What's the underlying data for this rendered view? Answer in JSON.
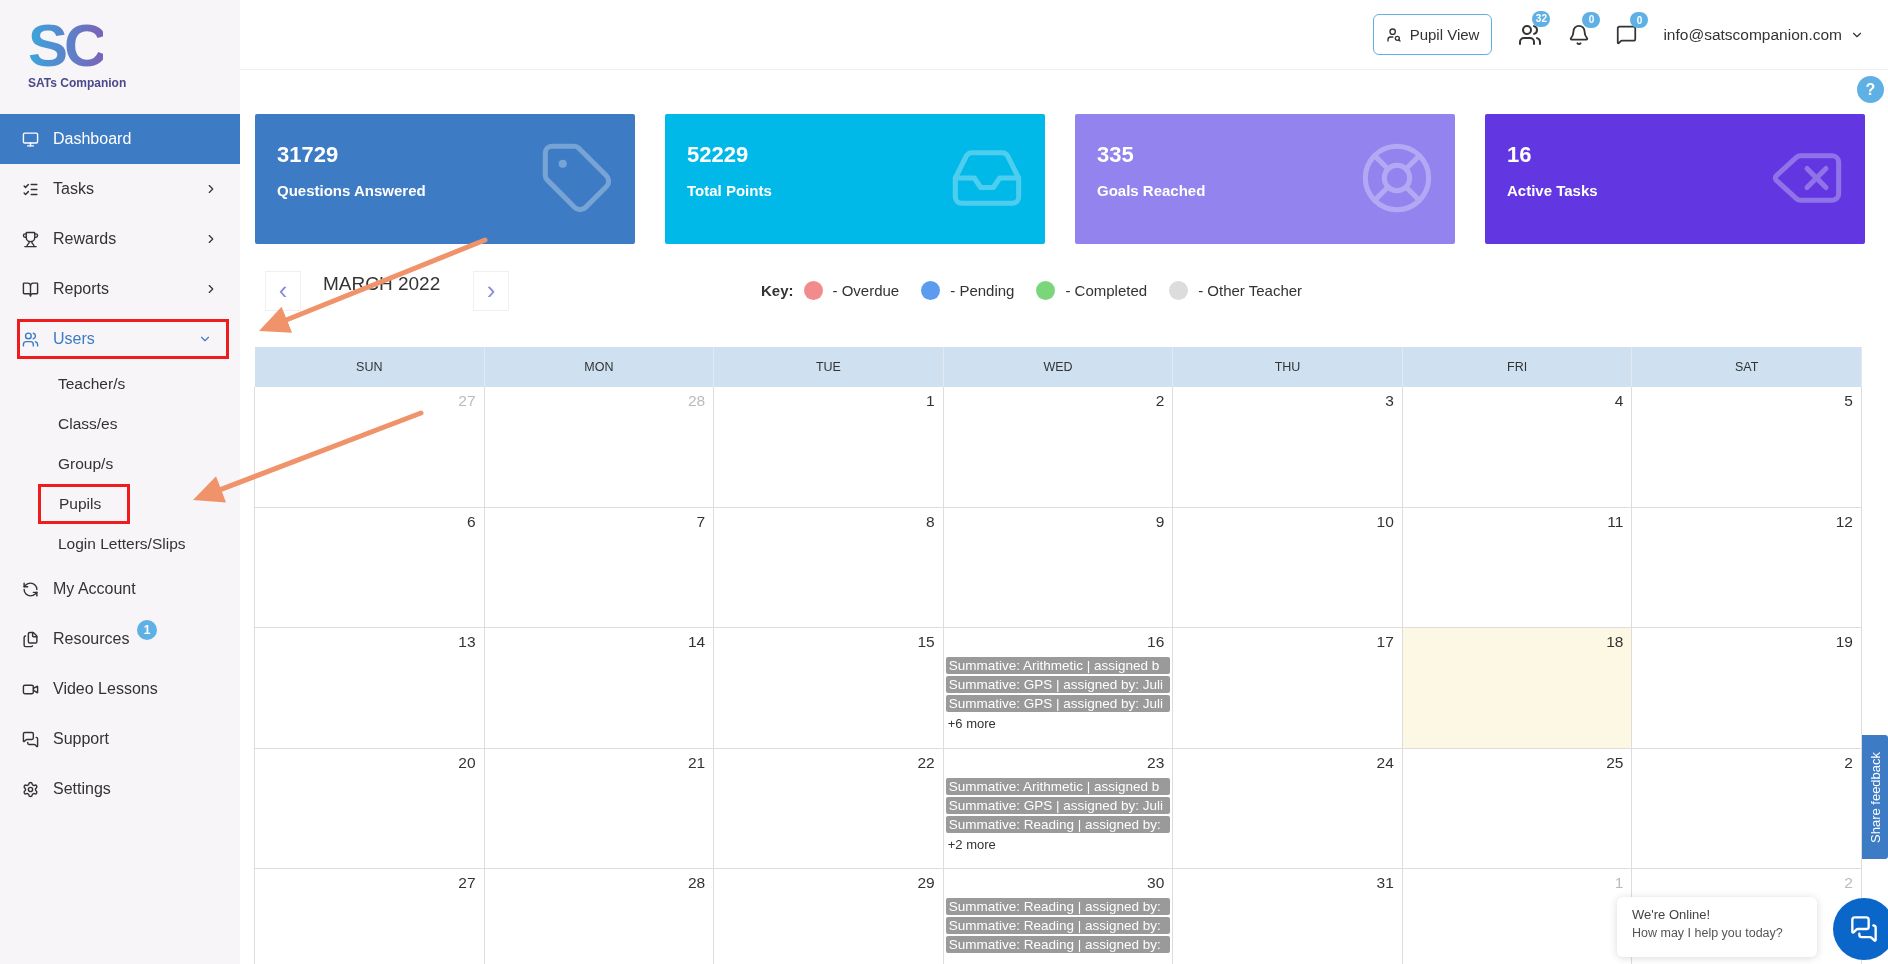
{
  "logo": {
    "mark": "SC",
    "name": "SATs Companion"
  },
  "sidebar": {
    "items": [
      {
        "label": "Dashboard",
        "selected": true,
        "has_arrow": false
      },
      {
        "label": "Tasks",
        "selected": false,
        "has_arrow": true
      },
      {
        "label": "Rewards",
        "selected": false,
        "has_arrow": true
      },
      {
        "label": "Reports",
        "selected": false,
        "has_arrow": true
      },
      {
        "label": "Users",
        "selected": false,
        "has_arrow": true,
        "expanded": true,
        "highlighted": true,
        "children": [
          {
            "label": "Teacher/s",
            "highlighted": false
          },
          {
            "label": "Class/es",
            "highlighted": false
          },
          {
            "label": "Group/s",
            "highlighted": false
          },
          {
            "label": "Pupils",
            "highlighted": true
          },
          {
            "label": "Login Letters/Slips",
            "highlighted": false
          }
        ]
      },
      {
        "label": "My Account",
        "selected": false,
        "has_arrow": false
      },
      {
        "label": "Resources",
        "selected": false,
        "has_arrow": false,
        "badge": "1"
      },
      {
        "label": "Video Lessons",
        "selected": false,
        "has_arrow": false
      },
      {
        "label": "Support",
        "selected": false,
        "has_arrow": false
      },
      {
        "label": "Settings",
        "selected": false,
        "has_arrow": false
      }
    ]
  },
  "header": {
    "pupil_view": "Pupil View",
    "pupils_badge": "32",
    "notifications_badge": "0",
    "messages_badge": "0",
    "account": "info@satscompanion.com",
    "help": "?"
  },
  "stats": [
    {
      "value": "31729",
      "label": "Questions Answered",
      "color": "#3d7bc4"
    },
    {
      "value": "52229",
      "label": "Total Points",
      "color": "#00b9e8"
    },
    {
      "value": "335",
      "label": "Goals Reached",
      "color": "#9283ef"
    },
    {
      "value": "16",
      "label": "Active Tasks",
      "color": "#6236e0"
    }
  ],
  "calendar": {
    "title": "MARCH 2022",
    "prev": "‹",
    "next": "›",
    "key": {
      "label": "Key:",
      "items": [
        {
          "label": "- Overdue",
          "color": "#f28b8b"
        },
        {
          "label": "- Pending",
          "color": "#5b9bf0"
        },
        {
          "label": "- Completed",
          "color": "#7bd67b"
        },
        {
          "label": "- Other Teacher",
          "color": "#dcdcdc"
        }
      ]
    },
    "weekdays": [
      "SUN",
      "MON",
      "TUE",
      "WED",
      "THU",
      "FRI",
      "SAT"
    ],
    "weeks": [
      [
        {
          "num": "27",
          "muted": true
        },
        {
          "num": "28",
          "muted": true
        },
        {
          "num": "1"
        },
        {
          "num": "2"
        },
        {
          "num": "3"
        },
        {
          "num": "4"
        },
        {
          "num": "5"
        }
      ],
      [
        {
          "num": "6"
        },
        {
          "num": "7"
        },
        {
          "num": "8"
        },
        {
          "num": "9"
        },
        {
          "num": "10"
        },
        {
          "num": "11"
        },
        {
          "num": "12"
        }
      ],
      [
        {
          "num": "13"
        },
        {
          "num": "14"
        },
        {
          "num": "15"
        },
        {
          "num": "16",
          "events": [
            "Summative: Arithmetic | assigned b",
            "Summative: GPS | assigned by: Juli",
            "Summative: GPS | assigned by: Juli"
          ],
          "more": "+6 more"
        },
        {
          "num": "17"
        },
        {
          "num": "18",
          "today": true
        },
        {
          "num": "19"
        }
      ],
      [
        {
          "num": "20"
        },
        {
          "num": "21"
        },
        {
          "num": "22"
        },
        {
          "num": "23",
          "events": [
            "Summative: Arithmetic | assigned b",
            "Summative: GPS | assigned by: Juli",
            "Summative: Reading | assigned by:"
          ],
          "more": "+2 more"
        },
        {
          "num": "24"
        },
        {
          "num": "25"
        },
        {
          "num": "2"
        }
      ],
      [
        {
          "num": "27"
        },
        {
          "num": "28"
        },
        {
          "num": "29"
        },
        {
          "num": "30",
          "events": [
            "Summative: Reading | assigned by:",
            "Summative: Reading | assigned by:",
            "Summative: Reading | assigned by:"
          ]
        },
        {
          "num": "31"
        },
        {
          "num": "1",
          "muted": true
        },
        {
          "num": "2",
          "muted": true
        }
      ]
    ]
  },
  "feedback": "Share feedback",
  "chat": {
    "title": "We're Online!",
    "subtitle": "How may I help you today?"
  }
}
